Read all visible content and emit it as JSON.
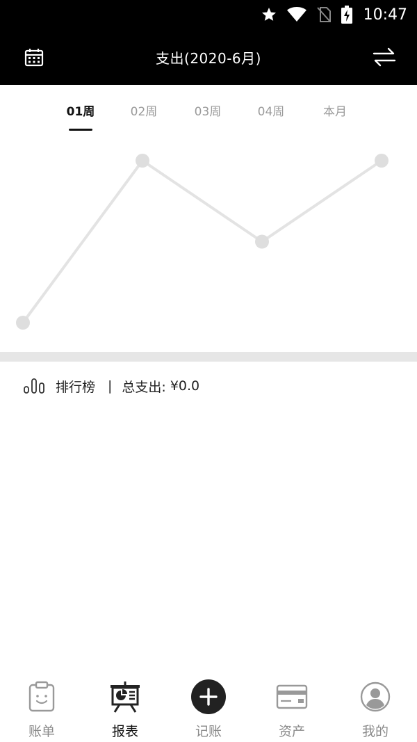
{
  "status_bar": {
    "time": "10:47",
    "icons": [
      "star-icon",
      "wifi-icon",
      "no-sim-icon",
      "battery-charging-icon"
    ]
  },
  "header": {
    "title": "支出(2020-6月)",
    "left_icon": "calendar-icon",
    "right_icon": "swap-arrows-icon"
  },
  "tabs": [
    {
      "label": "01周",
      "active": true
    },
    {
      "label": "02周",
      "active": false
    },
    {
      "label": "03周",
      "active": false
    },
    {
      "label": "04周",
      "active": false
    },
    {
      "label": "本月",
      "active": false
    }
  ],
  "chart_data": {
    "type": "line",
    "categories": [
      "",
      "",
      "",
      ""
    ],
    "series": [
      {
        "values": [
          0,
          1,
          0.5,
          1
        ]
      }
    ],
    "ylim": [
      0,
      1
    ],
    "grid": false,
    "colors": {
      "line": "#e3e3e3",
      "point": "#dedede"
    }
  },
  "ranking": {
    "icon": "bar-chart-icon",
    "label": "排行榜",
    "separator": "|",
    "total_label": "总支出:",
    "total_value": "¥0.0"
  },
  "bottom_nav": [
    {
      "label": "账单",
      "icon": "clipboard-smile-icon",
      "active": false
    },
    {
      "label": "报表",
      "icon": "report-board-icon",
      "active": true
    },
    {
      "label": "记账",
      "icon": "add-circle-icon",
      "active": false
    },
    {
      "label": "资产",
      "icon": "card-icon",
      "active": false
    },
    {
      "label": "我的",
      "icon": "profile-icon",
      "active": false
    }
  ],
  "colors": {
    "header_bg": "#000000",
    "active_text": "#111111",
    "inactive_text": "#9a9a9a",
    "divider": "#e6e6e6"
  }
}
